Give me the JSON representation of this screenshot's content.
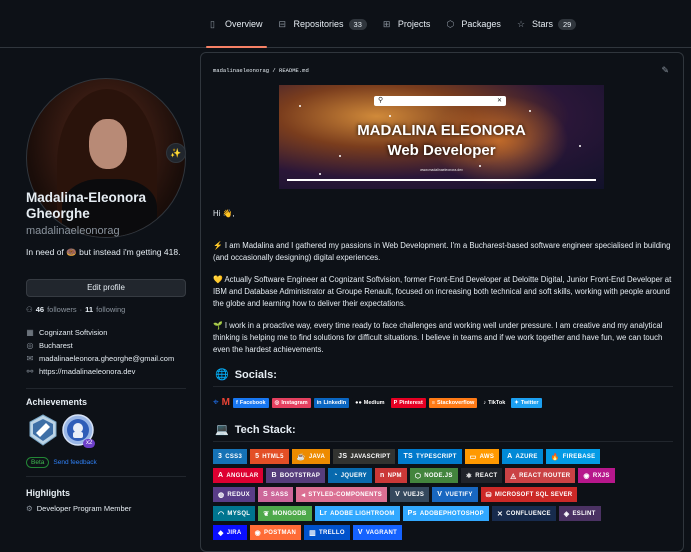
{
  "nav": {
    "tabs": [
      {
        "label": "Overview",
        "icon": "book-icon"
      },
      {
        "label": "Repositories",
        "count": "33",
        "icon": "repo-icon"
      },
      {
        "label": "Projects",
        "icon": "table-icon"
      },
      {
        "label": "Packages",
        "icon": "package-icon"
      },
      {
        "label": "Stars",
        "count": "29",
        "icon": "star-icon"
      }
    ]
  },
  "profile": {
    "name": "Madalina-Eleonora Gheorghe",
    "username": "madalinaeleonorag",
    "bio": "In need of 🍩 but instead i'm getting 418.",
    "edit_label": "Edit profile",
    "followers": "46",
    "followers_label": "followers",
    "dot": "·",
    "following": "11",
    "following_label": "following",
    "company": "Cognizant Softvision",
    "location": "Bucharest",
    "email": "madalinaeleonora.gheorghe@gmail.com",
    "website": "https://madalinaeleonora.dev",
    "status_emoji": "✨"
  },
  "achievements": {
    "title": "Achievements",
    "count_badge": "x2",
    "beta": "Beta",
    "feedback": "Send feedback"
  },
  "highlights": {
    "title": "Highlights",
    "item": "Developer Program Member"
  },
  "readme": {
    "path_user": "madalinaeleonorag",
    "path_sep": "/",
    "path_file": "README.md",
    "banner": {
      "title1": "MADALINA ELEONORA",
      "title2": "Web Developer",
      "url": "www.madalinaeleonora.dev"
    },
    "greeting": "Hi 👋,",
    "p1": "⚡ I am Madalina and I gathered my passions in Web Development. I'm a Bucharest-based software engineer specialised in building (and occasionally designing) digital experiences.",
    "p2": "💛 Actually Software Engineer at Cognizant Softvision, former Front-End Developer at Deloitte Digital, Junior Front-End Developer at IBM and Database Administrator at Groupe Renault, focused on increasing both technical and soft skills, working with people around the globe and learning how to deliver their expectations.",
    "p3": "🌱 I work in a proactive way, every time ready to face challenges and working well under pressure. I am creative and my analytical thinking is helping me to find solutions for difficult situations. I believe in teams and if we work together and have fun, we can touch even the hardest achievements.",
    "socials_title": "Socials:",
    "tech_title": "Tech Stack:",
    "socials": [
      {
        "label": "Facebook",
        "color": "#1877f2",
        "icon": "facebook-icon"
      },
      {
        "label": "Instagram",
        "color": "#e4405f",
        "icon": "instagram-icon"
      },
      {
        "label": "LinkedIn",
        "color": "#0a66c2",
        "icon": "linkedin-icon"
      },
      {
        "label": "Medium",
        "color": "#0d1117",
        "icon": "medium-icon"
      },
      {
        "label": "Pinterest",
        "color": "#e60023",
        "icon": "pinterest-icon"
      },
      {
        "label": "Stackoverflow",
        "color": "#fe7a16",
        "icon": "stackoverflow-icon"
      },
      {
        "label": "TikTok",
        "color": "#0d1117",
        "icon": "tiktok-icon"
      },
      {
        "label": "Twitter",
        "color": "#1ca0f1",
        "icon": "twitter-icon"
      }
    ],
    "tech_rows": [
      [
        {
          "label": "CSS3",
          "color": "#1572b6",
          "icon": "css3-icon"
        },
        {
          "label": "HTML5",
          "color": "#e34f26",
          "icon": "html5-icon"
        },
        {
          "label": "JAVA",
          "color": "#ed8b00",
          "icon": "java-icon"
        },
        {
          "label": "JAVASCRIPT",
          "color": "#323330",
          "icon": "javascript-icon"
        },
        {
          "label": "TYPESCRIPT",
          "color": "#007acc",
          "icon": "typescript-icon"
        },
        {
          "label": "AWS",
          "color": "#ff9900",
          "icon": "aws-icon"
        },
        {
          "label": "AZURE",
          "color": "#0089d6",
          "icon": "azure-icon"
        },
        {
          "label": "FIREBASE",
          "color": "#039be5",
          "icon": "firebase-icon"
        }
      ],
      [
        {
          "label": "ANGULAR",
          "color": "#dd0031",
          "icon": "angular-icon"
        },
        {
          "label": "BOOTSTRAP",
          "color": "#563d7c",
          "icon": "bootstrap-icon"
        },
        {
          "label": "JQUERY",
          "color": "#0769ad",
          "icon": "jquery-icon"
        },
        {
          "label": "NPM",
          "color": "#cb3837",
          "icon": "npm-icon"
        },
        {
          "label": "NODE.JS",
          "color": "#43853d",
          "icon": "nodejs-icon"
        },
        {
          "label": "REACT",
          "color": "#20232a",
          "icon": "react-icon"
        },
        {
          "label": "REACT ROUTER",
          "color": "#ca4245",
          "icon": "react-router-icon"
        },
        {
          "label": "RXJS",
          "color": "#b7178c",
          "icon": "rxjs-icon"
        }
      ],
      [
        {
          "label": "REDUX",
          "color": "#593d88",
          "icon": "redux-icon"
        },
        {
          "label": "SASS",
          "color": "#cc6699",
          "icon": "sass-icon"
        },
        {
          "label": "STYLED-COMPONENTS",
          "color": "#db7093",
          "icon": "styled-components-icon"
        },
        {
          "label": "VUEJS",
          "color": "#35495e",
          "icon": "vuejs-icon"
        },
        {
          "label": "VUETIFY",
          "color": "#1867c0",
          "icon": "vuetify-icon"
        },
        {
          "label": "MICROSOFT SQL SEVER",
          "color": "#cc2927",
          "icon": "mssql-icon"
        }
      ],
      [
        {
          "label": "MYSQL",
          "color": "#00758f",
          "icon": "mysql-icon"
        },
        {
          "label": "MONGODB",
          "color": "#4ea94b",
          "icon": "mongodb-icon"
        },
        {
          "label": "ADOBE LIGHTROOM",
          "color": "#31a8ff",
          "icon": "lightroom-icon"
        },
        {
          "label": "ADOBEPHOTOSHOP",
          "color": "#31a8ff",
          "icon": "photoshop-icon"
        },
        {
          "label": "CONFLUENCE",
          "color": "#172b4d",
          "icon": "confluence-icon"
        },
        {
          "label": "ESLINT",
          "color": "#4b3263",
          "icon": "eslint-icon"
        }
      ],
      [
        {
          "label": "JIRA",
          "color": "#0a0fff",
          "icon": "jira-icon"
        },
        {
          "label": "POSTMAN",
          "color": "#ff6c37",
          "icon": "postman-icon"
        },
        {
          "label": "TRELLO",
          "color": "#0052cc",
          "icon": "trello-icon"
        },
        {
          "label": "VAGRANT",
          "color": "#1563ff",
          "icon": "vagrant-icon"
        }
      ]
    ]
  }
}
